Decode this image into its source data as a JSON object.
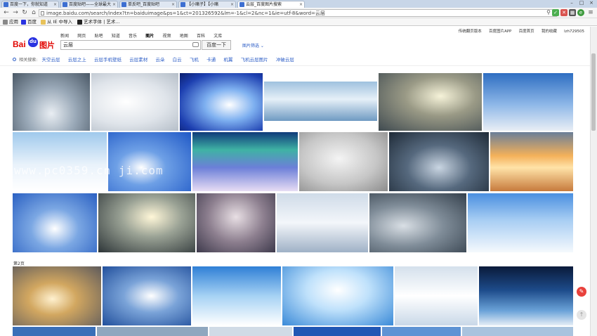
{
  "browser": {
    "tabs": [
      {
        "label": "百度一下，你就知道"
      },
      {
        "label": "百度贴吧——全球最大"
      },
      {
        "label": "单反吧_百度贴吧"
      },
      {
        "label": "【小赌子】【小赌"
      },
      {
        "label": "云层_百度图片搜索"
      }
    ],
    "url": "image.baidu.com/search/index?tn=baiduimage&ps=1&ct=201326592&lm=-1&cl=2&nc=1&ie=utf-8&word=云层",
    "bookmarks": [
      {
        "label": "应用"
      },
      {
        "label": "百度"
      },
      {
        "label": "从 IE 中导入"
      },
      {
        "label": "艺术字体 | 艺术..."
      }
    ]
  },
  "header": {
    "nav": [
      "新闻",
      "网页",
      "贴吧",
      "知道",
      "音乐",
      "图片",
      "视频",
      "地图",
      "百科",
      "文库"
    ],
    "current_nav": "图片",
    "user_links": [
      "传统翻页版本",
      "百度图片APP",
      "百度首页",
      "我的收藏",
      "lzh729505"
    ],
    "logo_text_left": "Bai",
    "logo_text_paw": "du",
    "logo_text_right": "图片",
    "search_value": "云层",
    "search_button": "百度一下",
    "filter_label": "图片筛选 ⌄"
  },
  "related": {
    "label": "相关搜索:",
    "items": [
      "天空云层",
      "云层之上",
      "云层手机壁纸",
      "云层素材",
      "云朵",
      "白云",
      "飞机",
      "卡通",
      "机翼",
      "飞机云层图片",
      "冲破云层"
    ]
  },
  "watermark": "www.pc0359.cn ji.com",
  "page_label": "第2页",
  "colors": {
    "baidu_red": "#e10602",
    "baidu_blue": "#2932e1",
    "link_blue": "#2b5cc6"
  }
}
